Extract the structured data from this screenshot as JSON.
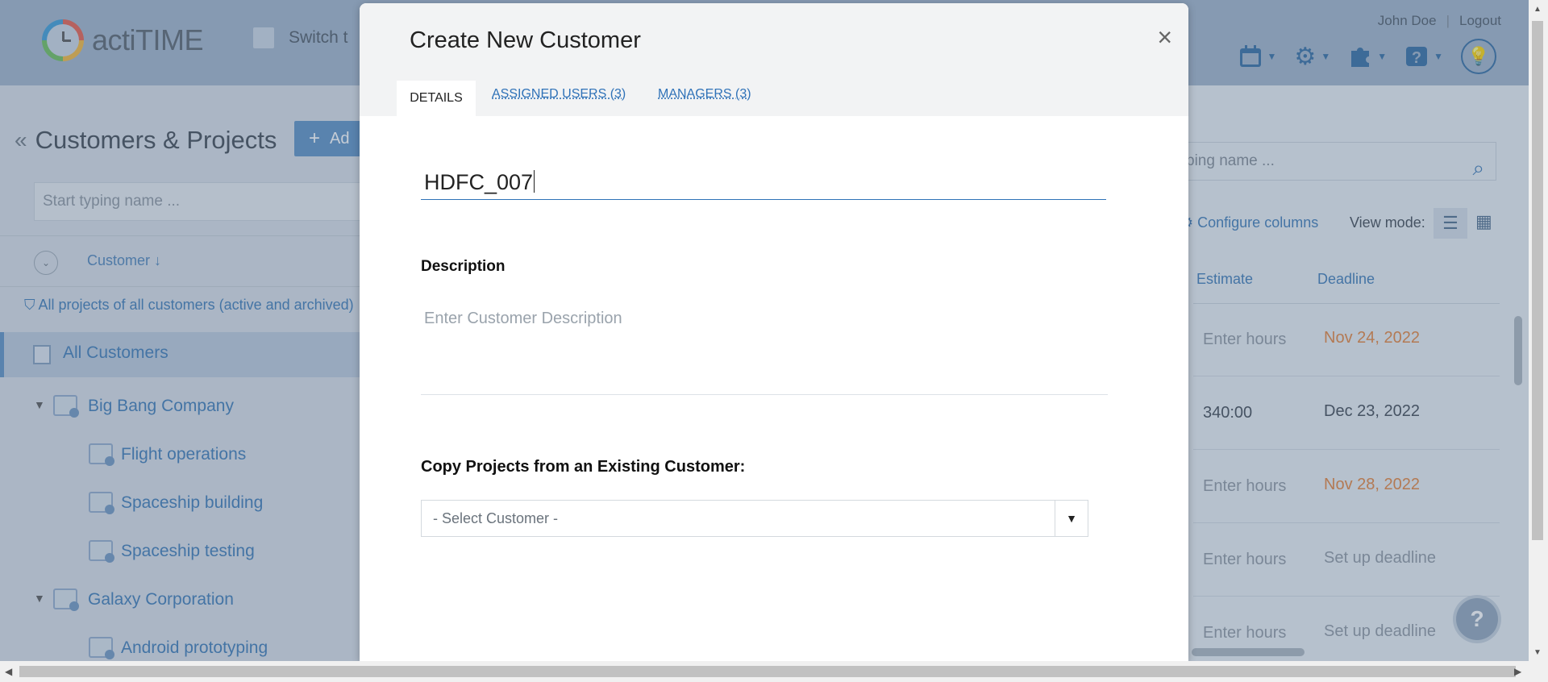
{
  "app": {
    "logo_text": "actiTIME",
    "switch_label": "Switch t",
    "user_name": "John Doe",
    "logout_label": "Logout"
  },
  "left_panel": {
    "title": "Customers & Projects",
    "add_label": "Ad",
    "search_placeholder": "Start typing name ...",
    "sort_column": "Customer",
    "filter_text": "All projects of all customers (active and archived)",
    "all_customers_label": "All Customers",
    "tree": [
      {
        "label": "Big Bang Company",
        "type": "customer"
      },
      {
        "label": "Flight operations",
        "type": "project"
      },
      {
        "label": "Spaceship building",
        "type": "project"
      },
      {
        "label": "Spaceship testing",
        "type": "project"
      },
      {
        "label": "Galaxy Corporation",
        "type": "customer"
      },
      {
        "label": "Android prototyping",
        "type": "project"
      }
    ]
  },
  "right_panel": {
    "search_placeholder": "ping name ...",
    "configure_label": "Configure columns",
    "view_mode_label": "View mode:",
    "col_estimate": "Estimate",
    "col_deadline": "Deadline",
    "rows": [
      {
        "estimate": "Enter hours",
        "deadline": "Nov 24, 2022"
      },
      {
        "estimate": "340:00",
        "deadline": "Dec 23, 2022"
      },
      {
        "estimate": "Enter hours",
        "deadline": "Nov 28, 2022"
      },
      {
        "estimate": "Enter hours",
        "deadline": "Set up deadline"
      },
      {
        "estimate": "Enter hours",
        "deadline": "Set up deadline"
      }
    ],
    "colors": {
      "overdue": "#e4823a",
      "link": "#3a79b5"
    }
  },
  "modal": {
    "title": "Create New Customer",
    "close_glyph": "×",
    "tabs": [
      {
        "label": "DETAILS"
      },
      {
        "label": "ASSIGNED USERS (3)"
      },
      {
        "label": "MANAGERS (3)"
      }
    ],
    "name_value": "HDFC_007",
    "description_label": "Description",
    "description_placeholder": "Enter Customer Description",
    "copy_label": "Copy Projects from an Existing Customer:",
    "select_value": "- Select Customer -"
  },
  "icons": [
    "calendar-icon",
    "gear-icon",
    "puzzle-icon",
    "help-icon",
    "lightbulb-icon",
    "search-icon",
    "filter-icon",
    "list-view-icon",
    "grid-view-icon",
    "folder-icon",
    "project-icon",
    "close-icon",
    "chevron-down-icon"
  ]
}
